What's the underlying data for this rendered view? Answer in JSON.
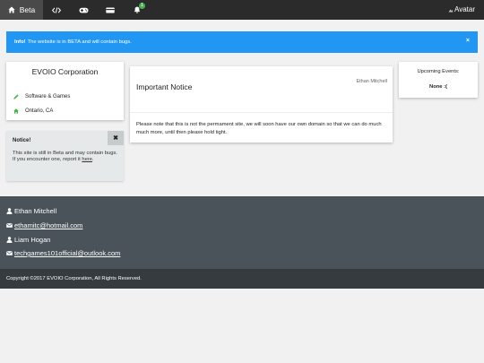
{
  "topbar": {
    "home_icon": "home-icon",
    "home_label": "Beta",
    "icons": [
      "code-icon",
      "gamepad-icon",
      "credit-card-icon",
      "bell-icon"
    ],
    "notification_count": "1",
    "avatar_label": "Avatar",
    "background": "#2b2b2b"
  },
  "alert": {
    "prefix": "Info!",
    "message": "The website is in BETA and will contain bugs.",
    "close": "×",
    "color": "#2196f3"
  },
  "company": {
    "name": "EVOIO Corporation",
    "industry": "Software & Games",
    "location": "Ontario, CA"
  },
  "notice": {
    "title": "Notice!",
    "close": "✖",
    "body_text": "This site is still in Beta and may contain bugs. If you encounter one, report it",
    "link": "here",
    "after_link": "."
  },
  "important": {
    "title": "Important Notice",
    "author": "Ethan Mitchell",
    "body": "Please note that this is not the permament site, we will soon have our own domain so that we can do much much more, until then please hold tight."
  },
  "events": {
    "title": "Upcoming Events:",
    "value": "None :("
  },
  "footer": {
    "contacts": [
      {
        "name": "Ethan Mitchell",
        "email": "ethamitc@hotmail.com"
      },
      {
        "name": "Liam Hogan",
        "email": "techgames101official@outlook.com"
      }
    ],
    "copyright": "Copyright ©2017 EVOIO Corporation, All Rights Reserved."
  }
}
